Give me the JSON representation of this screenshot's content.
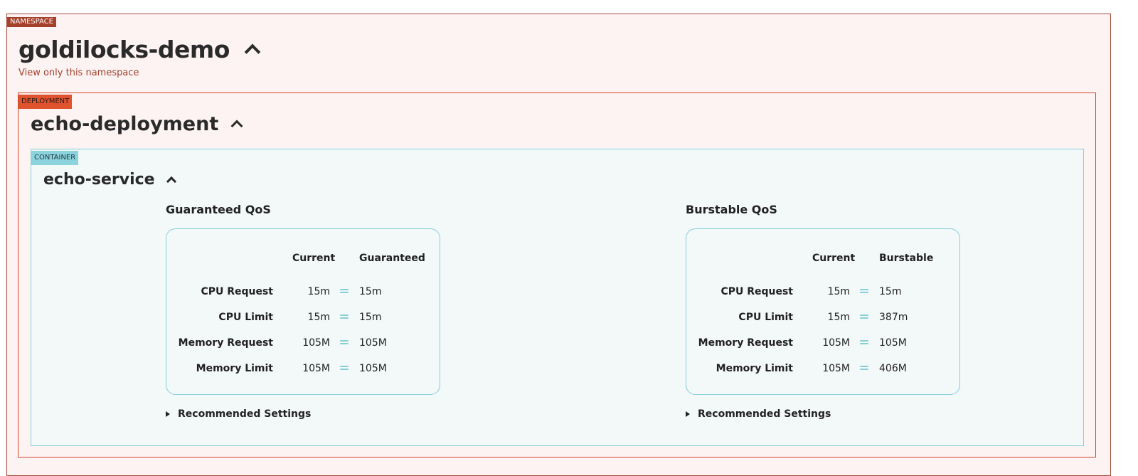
{
  "namespace": {
    "tag": "NAMESPACE",
    "name": "goldilocks-demo",
    "view_link": "View only this namespace"
  },
  "deployment": {
    "tag": "DEPLOYMENT",
    "name": "echo-deployment"
  },
  "container": {
    "tag": "CONTAINER",
    "name": "echo-service"
  },
  "guaranteed": {
    "heading": "Guaranteed QoS",
    "col_current": "Current",
    "col_rec": "Guaranteed",
    "rows": [
      {
        "label": "CPU Request",
        "current": "15m",
        "rec": "15m"
      },
      {
        "label": "CPU Limit",
        "current": "15m",
        "rec": "15m"
      },
      {
        "label": "Memory Request",
        "current": "105M",
        "rec": "105M"
      },
      {
        "label": "Memory Limit",
        "current": "105M",
        "rec": "105M"
      }
    ],
    "recommended": "Recommended Settings"
  },
  "burstable": {
    "heading": "Burstable QoS",
    "col_current": "Current",
    "col_rec": "Burstable",
    "rows": [
      {
        "label": "CPU Request",
        "current": "15m",
        "rec": "15m"
      },
      {
        "label": "CPU Limit",
        "current": "15m",
        "rec": "387m"
      },
      {
        "label": "Memory Request",
        "current": "105M",
        "rec": "105M"
      },
      {
        "label": "Memory Limit",
        "current": "105M",
        "rec": "406M"
      }
    ],
    "recommended": "Recommended Settings"
  },
  "colors": {
    "namespace_tag": "#a5412b",
    "deployment_border": "#d0482b",
    "container_border": "#86cfd9"
  }
}
